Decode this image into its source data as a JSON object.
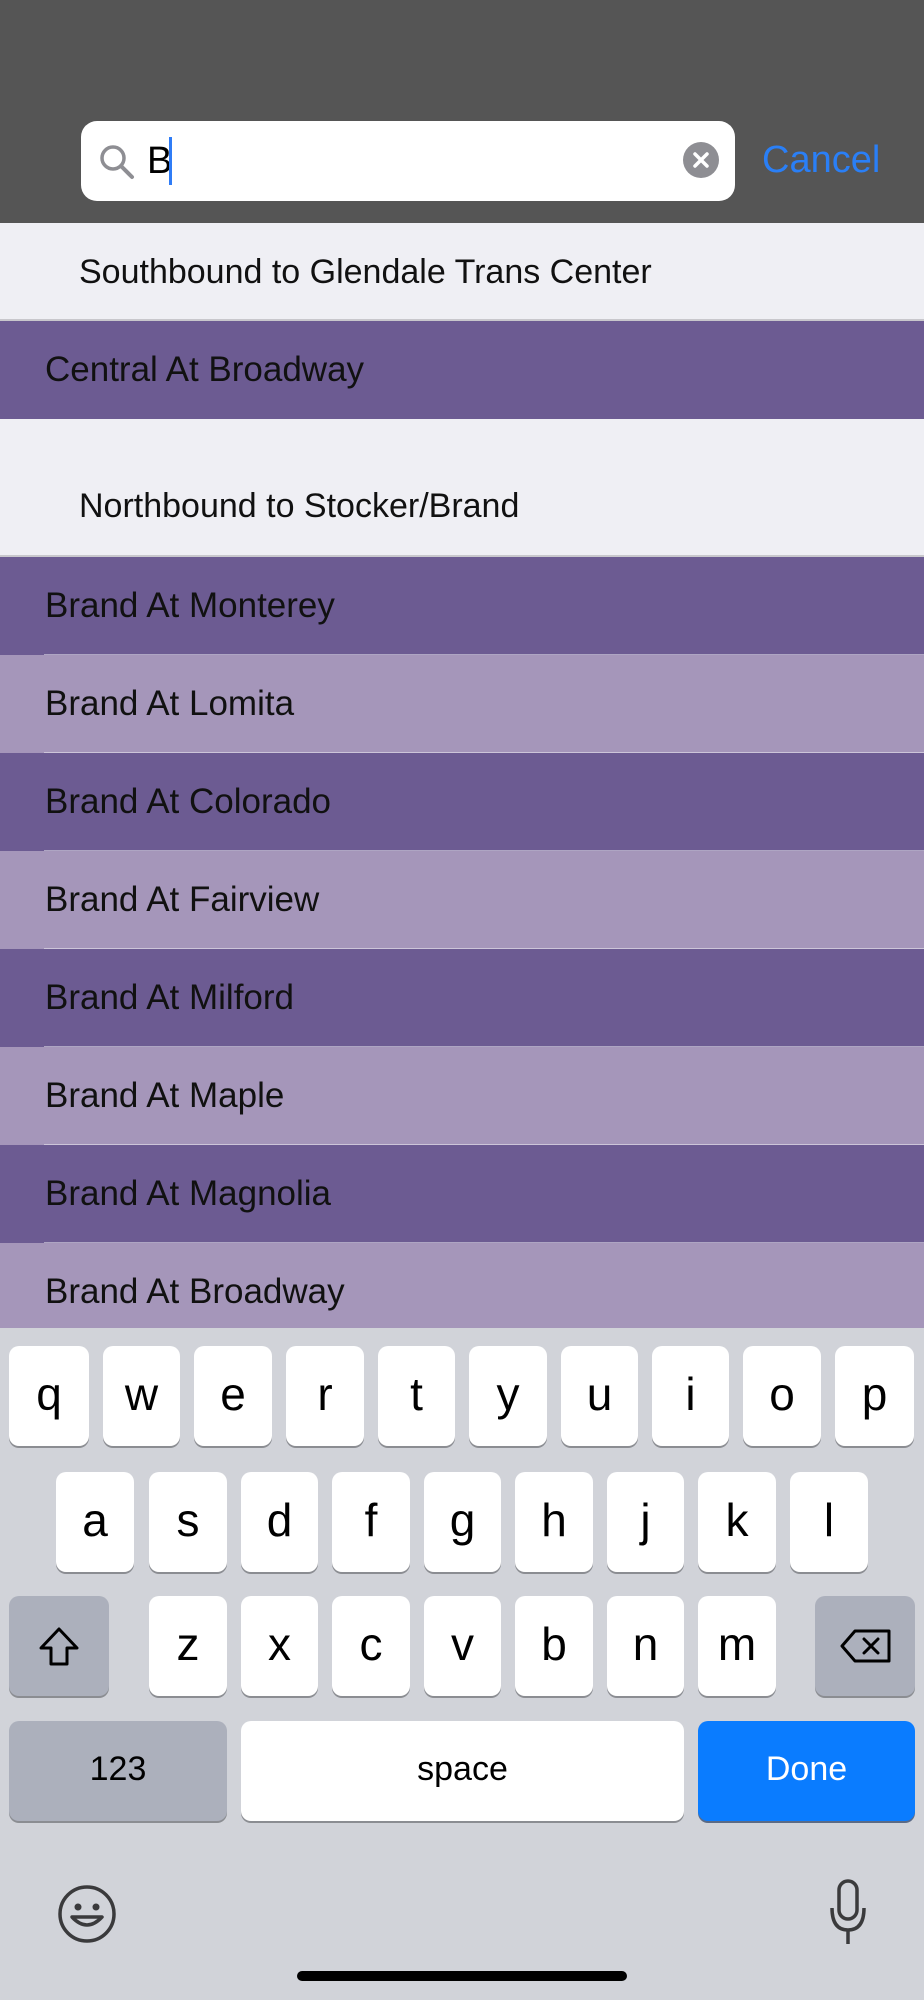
{
  "search": {
    "query": "B",
    "cancel_label": "Cancel"
  },
  "results": {
    "sections": [
      {
        "header": "Southbound to Glendale Trans Center",
        "stops": [
          "Central At Broadway"
        ]
      },
      {
        "header": "Northbound to Stocker/Brand",
        "stops": [
          "Brand At Monterey",
          "Brand At Lomita",
          "Brand At Colorado",
          "Brand At Fairview",
          "Brand At Milford",
          "Brand At Maple",
          "Brand At Magnolia",
          "Brand At Broadway"
        ]
      }
    ]
  },
  "keyboard": {
    "row1": [
      "q",
      "w",
      "e",
      "r",
      "t",
      "y",
      "u",
      "i",
      "o",
      "p"
    ],
    "row2": [
      "a",
      "s",
      "d",
      "f",
      "g",
      "h",
      "j",
      "k",
      "l"
    ],
    "row3": [
      "z",
      "x",
      "c",
      "v",
      "b",
      "n",
      "m"
    ],
    "numbers_label": "123",
    "space_label": "space",
    "done_label": "Done"
  },
  "colors": {
    "row_dark": "#6c5b92",
    "row_light": "#a596ba",
    "accent": "#0a7cff"
  },
  "icons": [
    "search-icon",
    "clear-icon",
    "shift-icon",
    "backspace-icon",
    "emoji-icon",
    "microphone-icon"
  ]
}
